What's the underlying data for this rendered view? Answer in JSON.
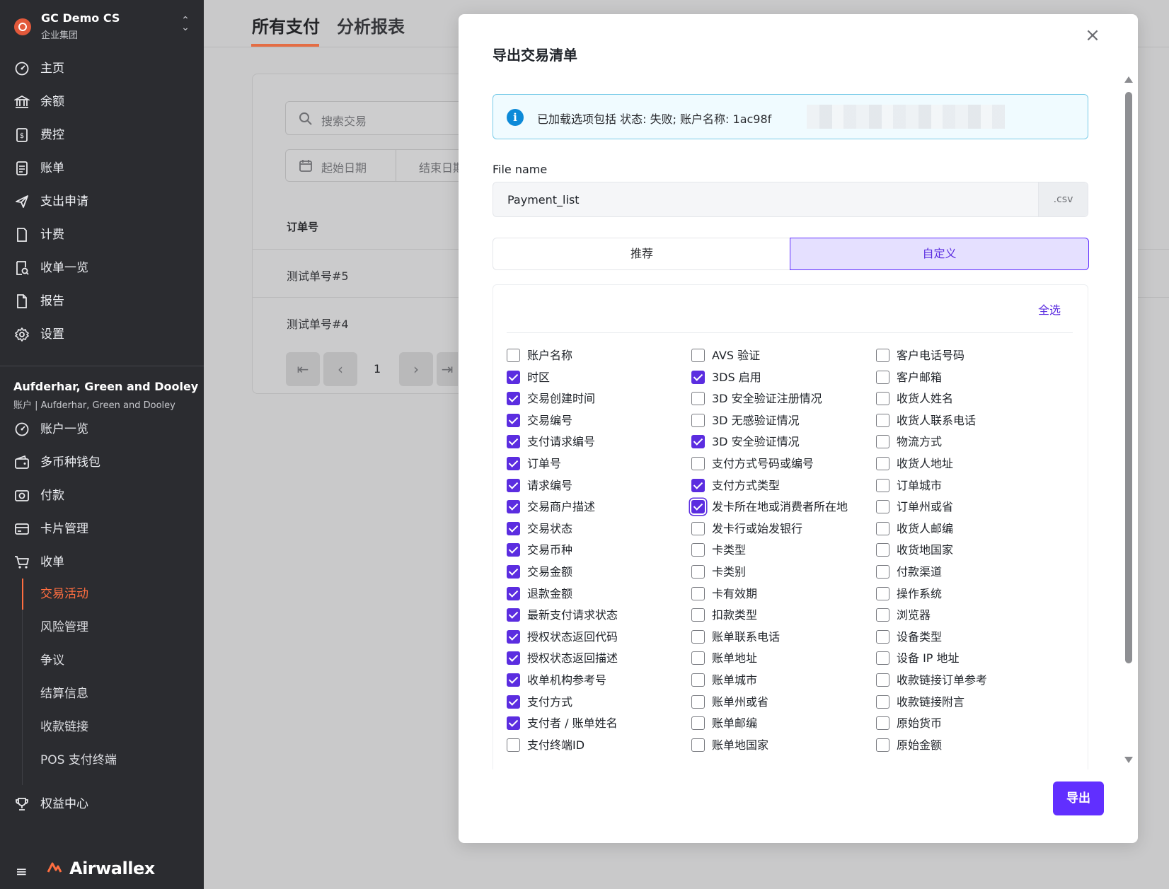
{
  "org": {
    "name": "GC Demo CS",
    "sub": "企业集团"
  },
  "nav_primary": [
    {
      "label": "主页",
      "icon": "dashboard-icon"
    },
    {
      "label": "余额",
      "icon": "bank-icon"
    },
    {
      "label": "费控",
      "icon": "expense-icon"
    },
    {
      "label": "账单",
      "icon": "bill-icon"
    },
    {
      "label": "支出申请",
      "icon": "send-icon"
    },
    {
      "label": "计费",
      "icon": "document-icon"
    },
    {
      "label": "收单一览",
      "icon": "receipt-search-icon"
    },
    {
      "label": "报告",
      "icon": "report-icon"
    },
    {
      "label": "设置",
      "icon": "gear-icon"
    }
  ],
  "account": {
    "name": "Aufderhar, Green and Dooley",
    "sub": "账户 | Aufderhar, Green and Dooley"
  },
  "nav_account": [
    {
      "label": "账户一览",
      "icon": "dashboard-icon"
    },
    {
      "label": "多币种钱包",
      "icon": "wallet-icon"
    },
    {
      "label": "付款",
      "icon": "payout-icon"
    },
    {
      "label": "卡片管理",
      "icon": "card-icon"
    },
    {
      "label": "收单",
      "icon": "cart-icon"
    }
  ],
  "nav_sub": [
    "交易活动",
    "风险管理",
    "争议",
    "结算信息",
    "收款链接",
    "POS 支付终端"
  ],
  "nav_bottom": {
    "label": "权益中心",
    "icon": "trophy-icon"
  },
  "brand": {
    "name": "Airwallex",
    "accent": "#ff6e40"
  },
  "main": {
    "tabs": [
      "所有支付",
      "分析报表"
    ],
    "search_placeholder": "搜索交易",
    "date_start": "起始日期",
    "date_end": "结束日期",
    "column_header": "订单号",
    "rows": [
      "测试单号#5",
      "测试单号#4"
    ],
    "page": "1"
  },
  "modal": {
    "title": "导出交易清单",
    "info_text": "已加载选项包括 状态: 失败; 账户名称: 1ac98f",
    "file_name_label": "File name",
    "file_name_value": "Payment_list",
    "file_ext": ".csv",
    "seg_recommended": "推荐",
    "seg_custom": "自定义",
    "select_all": "全选",
    "export_label": "导出",
    "accent": "#612fff",
    "columns": [
      [
        {
          "label": "账户名称",
          "checked": false
        },
        {
          "label": "时区",
          "checked": true
        },
        {
          "label": "交易创建时间",
          "checked": true
        },
        {
          "label": "交易编号",
          "checked": true
        },
        {
          "label": "支付请求编号",
          "checked": true
        },
        {
          "label": "订单号",
          "checked": true
        },
        {
          "label": "请求编号",
          "checked": true
        },
        {
          "label": "交易商户描述",
          "checked": true
        },
        {
          "label": "交易状态",
          "checked": true
        },
        {
          "label": "交易币种",
          "checked": true
        },
        {
          "label": "交易金额",
          "checked": true
        },
        {
          "label": "退款金额",
          "checked": true
        },
        {
          "label": "最新支付请求状态",
          "checked": true
        },
        {
          "label": "授权状态返回代码",
          "checked": true
        },
        {
          "label": "授权状态返回描述",
          "checked": true
        },
        {
          "label": "收单机构参考号",
          "checked": true
        },
        {
          "label": "支付方式",
          "checked": true
        },
        {
          "label": "支付者 / 账单姓名",
          "checked": true
        },
        {
          "label": "支付终端ID",
          "checked": false
        }
      ],
      [
        {
          "label": "AVS 验证",
          "checked": false
        },
        {
          "label": "3DS 启用",
          "checked": true
        },
        {
          "label": "3D 安全验证注册情况",
          "checked": false
        },
        {
          "label": "3D 无感验证情况",
          "checked": false
        },
        {
          "label": "3D 安全验证情况",
          "checked": true
        },
        {
          "label": "支付方式号码或编号",
          "checked": false
        },
        {
          "label": "支付方式类型",
          "checked": true
        },
        {
          "label": "发卡所在地或消费者所在地",
          "checked": true,
          "focused": true
        },
        {
          "label": "发卡行或始发银行",
          "checked": false
        },
        {
          "label": "卡类型",
          "checked": false
        },
        {
          "label": "卡类别",
          "checked": false
        },
        {
          "label": "卡有效期",
          "checked": false
        },
        {
          "label": "扣款类型",
          "checked": false
        },
        {
          "label": "账单联系电话",
          "checked": false
        },
        {
          "label": "账单地址",
          "checked": false
        },
        {
          "label": "账单城市",
          "checked": false
        },
        {
          "label": "账单州或省",
          "checked": false
        },
        {
          "label": "账单邮编",
          "checked": false
        },
        {
          "label": "账单地国家",
          "checked": false
        }
      ],
      [
        {
          "label": "客户电话号码",
          "checked": false
        },
        {
          "label": "客户邮箱",
          "checked": false
        },
        {
          "label": "收货人姓名",
          "checked": false
        },
        {
          "label": "收货人联系电话",
          "checked": false
        },
        {
          "label": "物流方式",
          "checked": false
        },
        {
          "label": "收货人地址",
          "checked": false
        },
        {
          "label": "订单城市",
          "checked": false
        },
        {
          "label": "订单州或省",
          "checked": false
        },
        {
          "label": "收货人邮编",
          "checked": false
        },
        {
          "label": "收货地国家",
          "checked": false
        },
        {
          "label": "付款渠道",
          "checked": false
        },
        {
          "label": "操作系统",
          "checked": false
        },
        {
          "label": "浏览器",
          "checked": false
        },
        {
          "label": "设备类型",
          "checked": false
        },
        {
          "label": "设备 IP 地址",
          "checked": false
        },
        {
          "label": "收款链接订单参考",
          "checked": false
        },
        {
          "label": "收款链接附言",
          "checked": false
        },
        {
          "label": "原始货币",
          "checked": false
        },
        {
          "label": "原始金额",
          "checked": false
        }
      ]
    ]
  }
}
